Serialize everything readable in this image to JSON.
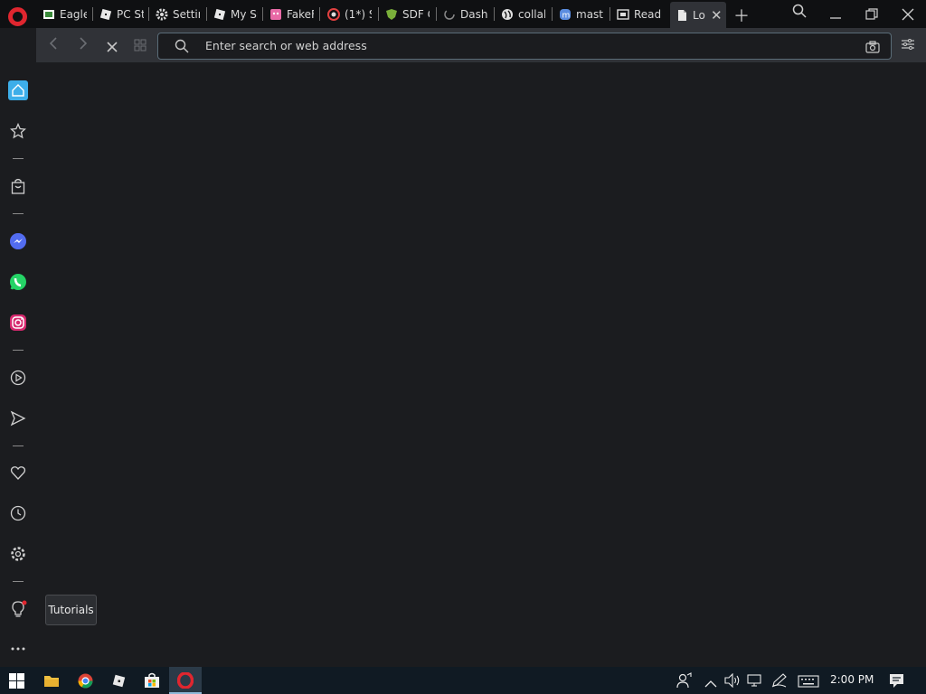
{
  "tabs": [
    {
      "label": "Eagle",
      "icon": "image-icon"
    },
    {
      "label": "PC St",
      "icon": "roblox-icon"
    },
    {
      "label": "Settir",
      "icon": "gear-icon"
    },
    {
      "label": "My Sr",
      "icon": "roblox-icon"
    },
    {
      "label": "FakeF",
      "icon": "pink-face-icon"
    },
    {
      "label": "(1*) S",
      "icon": "red-circle-icon"
    },
    {
      "label": "SDF C",
      "icon": "green-shield-icon"
    },
    {
      "label": "Dashl",
      "icon": "loading-icon"
    },
    {
      "label": "collab",
      "icon": "globe-icon"
    },
    {
      "label": "masto",
      "icon": "mastodon-icon"
    },
    {
      "label": "Read",
      "icon": "reader-icon"
    },
    {
      "label": "Lo",
      "icon": "document-icon"
    }
  ],
  "address_bar": {
    "placeholder": "Enter search or web address"
  },
  "tooltip": "Tutorials",
  "clock": "2:00 PM",
  "colors": {
    "accent": "#3daee9",
    "opera_red": "#e0262f",
    "taskbar": "#101a23"
  }
}
